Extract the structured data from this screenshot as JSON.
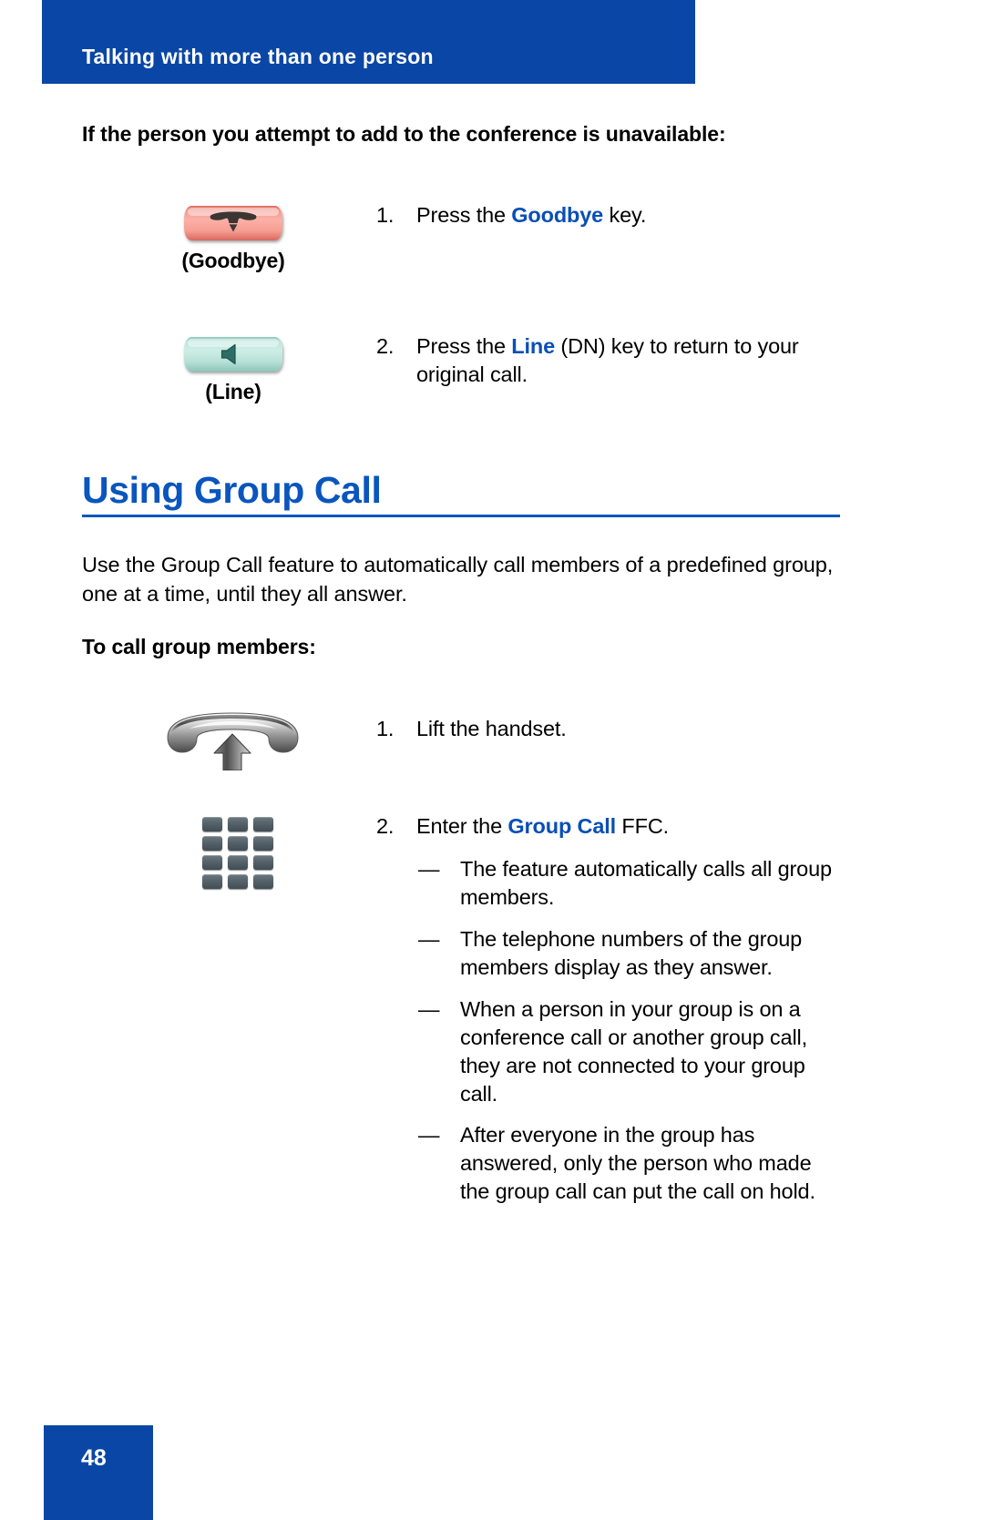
{
  "page": {
    "running_header": "Talking with more than one person",
    "folio": "48",
    "accent_blue": "#0A46A5",
    "heading_blue": "#0A55BE",
    "keyword_blue": "#0A4FB5"
  },
  "section_unavailable": {
    "heading": "If the person you attempt to add to the conference is unavailable:",
    "steps": [
      {
        "number": "1.",
        "pre": "Press the ",
        "keyword": "Goodbye",
        "post": " key.",
        "icon_label": "(Goodbye)",
        "icon_name": "goodbye-key"
      },
      {
        "number": "2.",
        "pre": "Press the ",
        "keyword": "Line",
        "post": " (DN) key to return to your original call.",
        "icon_label": "(Line)",
        "icon_name": "line-key"
      }
    ]
  },
  "section_group_call": {
    "title": "Using Group Call",
    "intro": "Use the Group Call feature to automatically call members of a predefined group, one at a time, until they all answer.",
    "sub_heading": "To call group members:",
    "steps": [
      {
        "number": "1.",
        "pre": "Lift the handset.",
        "keyword": "",
        "post": "",
        "icon_name": "lift-handset"
      },
      {
        "number": "2.",
        "pre": "Enter the ",
        "keyword": "Group Call",
        "post": " FFC.",
        "icon_name": "dial-keypad"
      }
    ],
    "notes": [
      {
        "dash": "—",
        "text": "The feature automatically calls all group members."
      },
      {
        "dash": "—",
        "text": "The telephone numbers of the group members display as they answer."
      },
      {
        "dash": "—",
        "text": "When a person in your group is on a conference call or another group call, they are not connected to your group call."
      },
      {
        "dash": "—",
        "text": "After everyone in the group has answered, only the person who made the group call can put the call on hold."
      }
    ]
  }
}
